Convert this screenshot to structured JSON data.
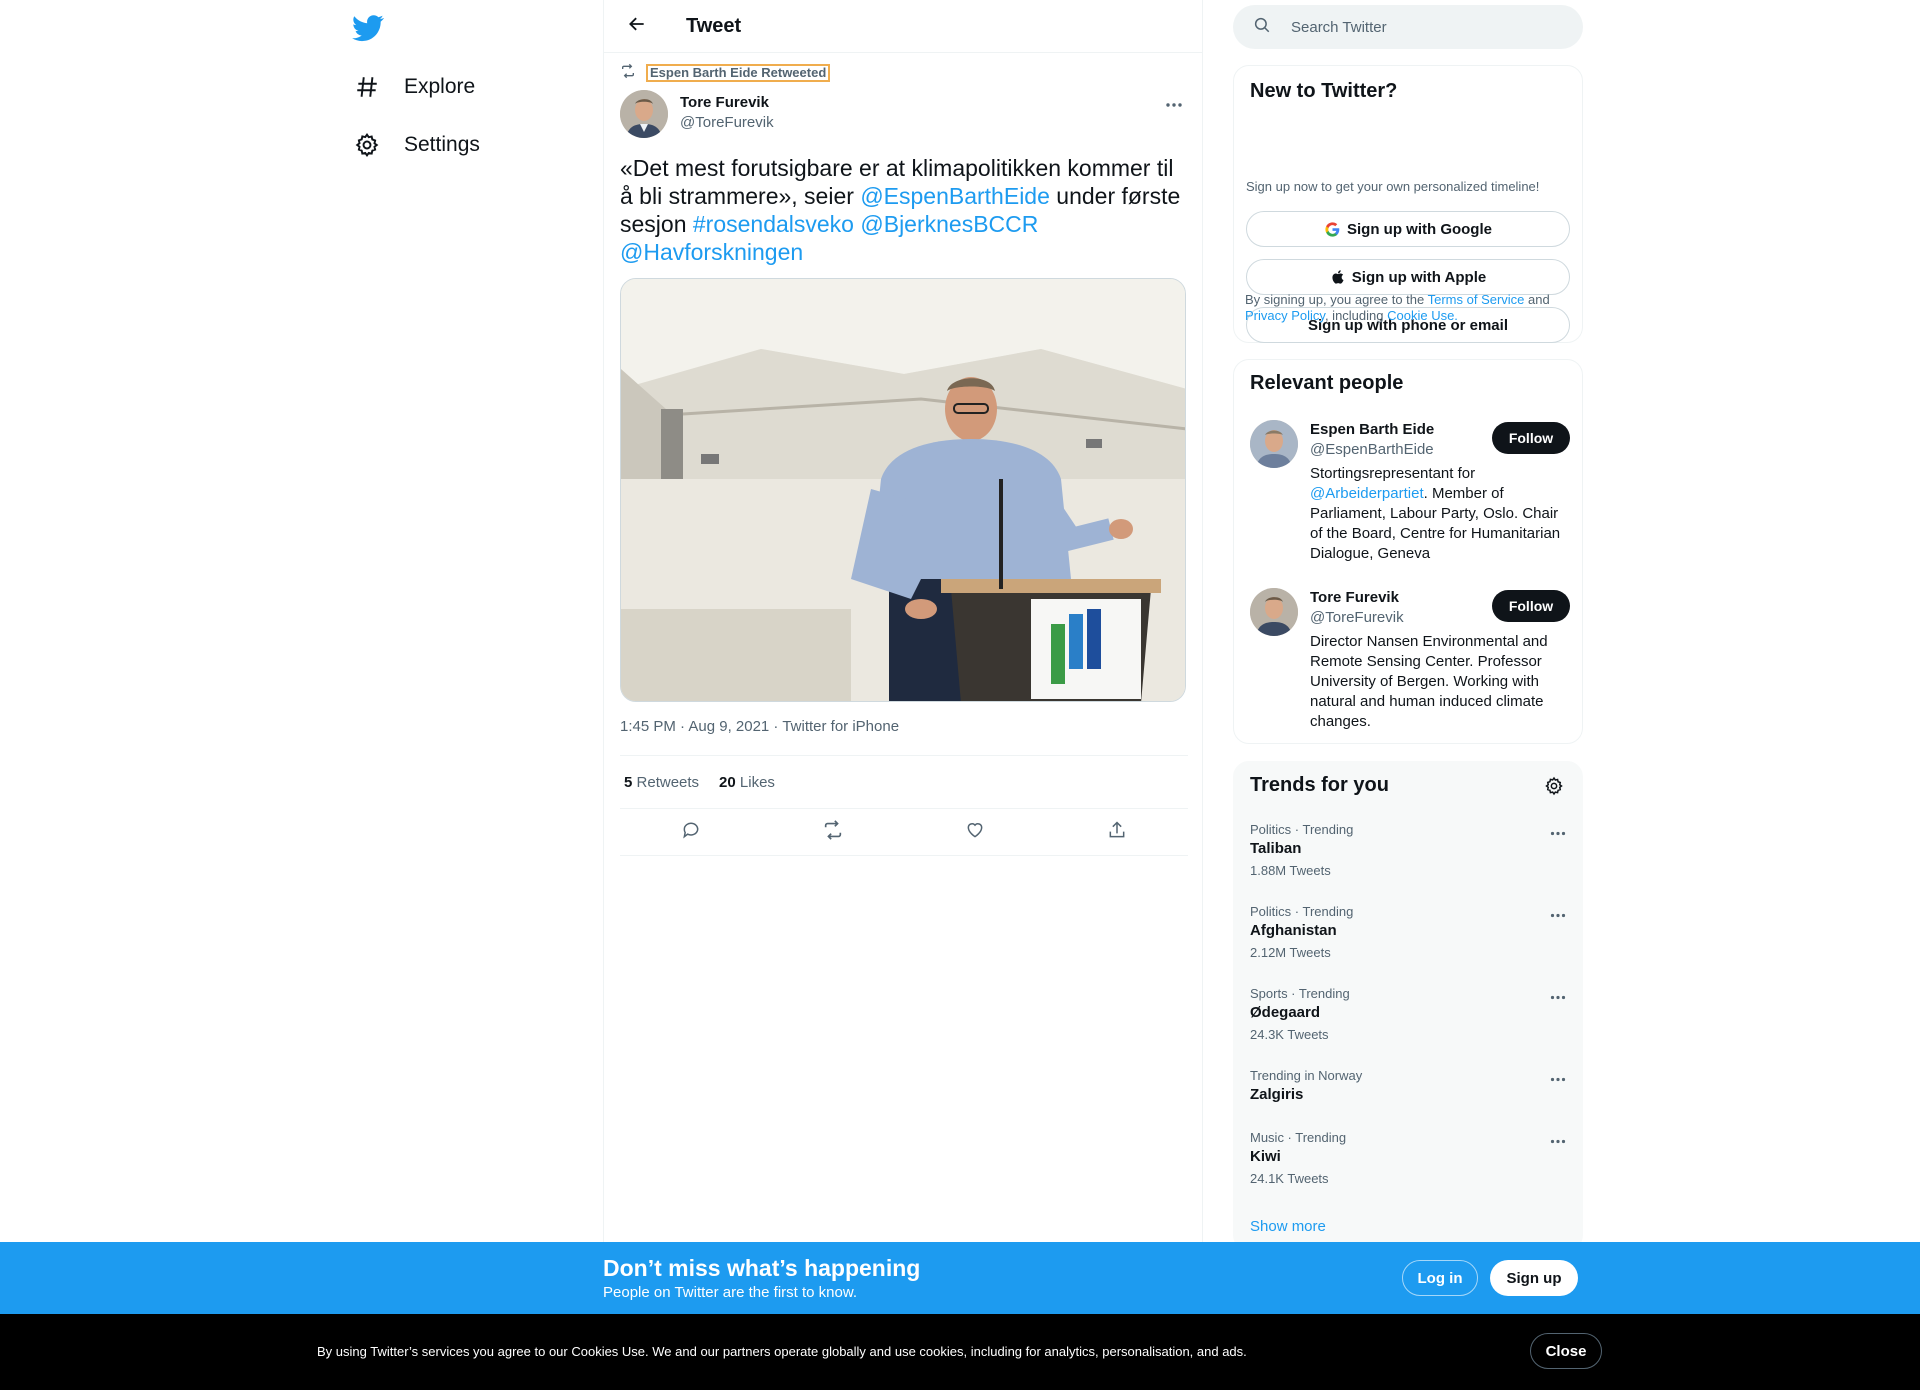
{
  "colors": {
    "accent": "#1d9bf0",
    "text": "#0f1419",
    "muted": "#536471",
    "banner": "#1d9bf0",
    "cookie_bar": "#000000"
  },
  "nav": {
    "logo_icon": "twitter-bird-icon",
    "items": [
      {
        "label": "Explore",
        "icon": "hashtag-icon"
      },
      {
        "label": "Settings",
        "icon": "gear-icon"
      }
    ]
  },
  "header": {
    "title": "Tweet",
    "back_icon": "arrow-left-icon"
  },
  "tweet": {
    "retweeted_by": "Espen Barth Eide Retweeted",
    "author_name": "Tore Furevik",
    "author_handle": "@ToreFurevik",
    "text_parts": [
      {
        "text": "«Det mest forutsigbare er at klimapolitikken kommer til å bli strammere», seier ",
        "link": false
      },
      {
        "text": "@EspenBarthEide",
        "link": true
      },
      {
        "text": " under første sesjon ",
        "link": false
      },
      {
        "text": "#rosendalsveko",
        "link": true
      },
      {
        "text": " ",
        "link": false
      },
      {
        "text": "@BjerknesBCCR",
        "link": true
      },
      {
        "text": " ",
        "link": false
      },
      {
        "text": "@Havforskningen",
        "link": true
      }
    ],
    "timestamp": "1:45 PM · Aug 9, 2021 · Twitter for iPhone",
    "retweets_count": "5",
    "retweets_label": "Retweets",
    "likes_count": "20",
    "likes_label": "Likes",
    "photo_description_icon": "photo-speaker-at-podium"
  },
  "search": {
    "placeholder": "Search Twitter"
  },
  "new_to_twitter": {
    "title": "New to Twitter?",
    "subtitle": "Sign up now to get your own personalized timeline!",
    "google": "Sign up with Google",
    "apple": "Sign up with Apple",
    "phone": "Sign up with phone or email",
    "legal_prefix": "By signing up, you agree to the ",
    "tos": "Terms of Service",
    "and": " and ",
    "privacy": "Privacy Policy",
    "including": ", including ",
    "cookie": "Cookie Use."
  },
  "relevant_people": {
    "title": "Relevant people",
    "people": [
      {
        "name": "Espen Barth Eide",
        "handle": "@EspenBarthEide",
        "follow": "Follow",
        "bio_prefix": "Stortingsrepresentant for ",
        "bio_link": "@Arbeiderpartiet",
        "bio_suffix": ". Member of Parliament, Labour Party, Oslo. Chair of the Board, Centre for Humanitarian Dialogue, Geneva"
      },
      {
        "name": "Tore Furevik",
        "handle": "@ToreFurevik",
        "follow": "Follow",
        "bio_prefix": "Director Nansen Environmental and Remote Sensing Center. Professor University of Bergen. Working with natural and human induced climate changes.",
        "bio_link": "",
        "bio_suffix": ""
      }
    ]
  },
  "trends": {
    "title": "Trends for you",
    "items": [
      {
        "meta": "Politics · Trending",
        "name": "Taliban",
        "count": "1.88M Tweets"
      },
      {
        "meta": "Politics · Trending",
        "name": "Afghanistan",
        "count": "2.12M Tweets"
      },
      {
        "meta": "Sports · Trending",
        "name": "Ødegaard",
        "count": "24.3K Tweets"
      },
      {
        "meta": "Trending in Norway",
        "name": "Zalgiris",
        "count": ""
      },
      {
        "meta": "Music · Trending",
        "name": "Kiwi",
        "count": "24.1K Tweets"
      }
    ],
    "show_more": "Show more"
  },
  "banner": {
    "title": "Don’t miss what’s happening",
    "subtitle": "People on Twitter are the first to know.",
    "login": "Log in",
    "signup": "Sign up"
  },
  "cookie_bar": {
    "text": "By using Twitter’s services you agree to our Cookies Use. We and our partners operate globally and use cookies, including for analytics, personalisation, and ads.",
    "close": "Close"
  }
}
